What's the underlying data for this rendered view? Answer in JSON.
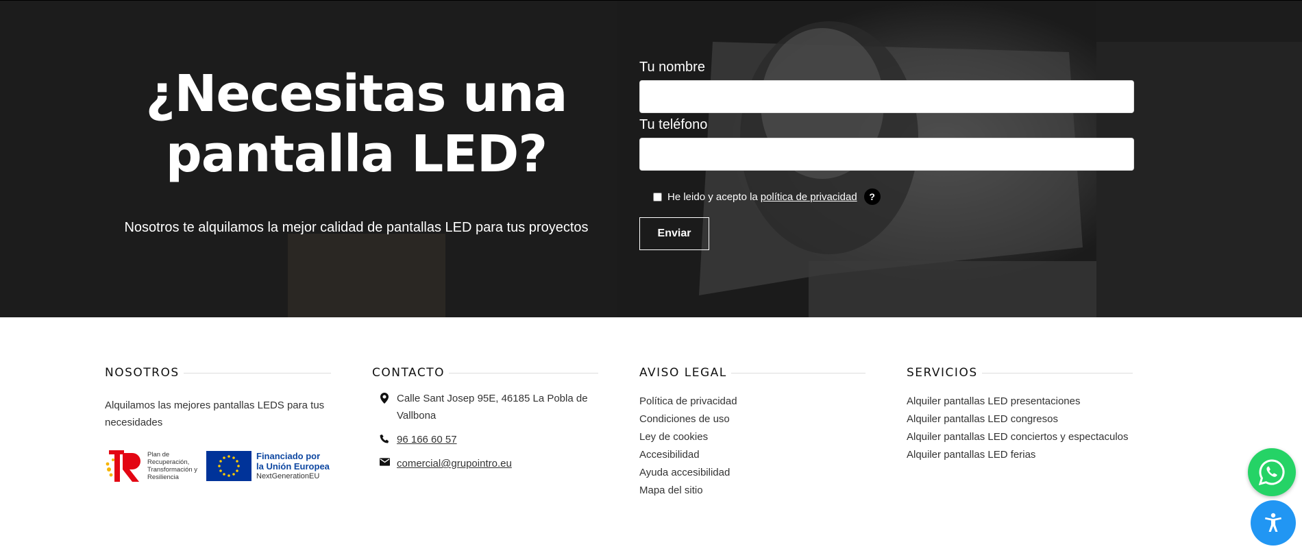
{
  "hero": {
    "title_line1": "¿Necesitas una",
    "title_line2": "pantalla LED?",
    "subtitle": "Nosotros te alquilamos la mejor calidad de pantallas LED para tus proyectos"
  },
  "form": {
    "name_label": "Tu nombre",
    "phone_label": "Tu teléfono",
    "consent_prefix": "He leido y acepto la",
    "consent_link": "política de privacidad",
    "help_glyph": "?",
    "submit_label": "Enviar"
  },
  "footer": {
    "nosotros": {
      "title": "NOSOTROS",
      "text": "Alquilamos las mejores pantallas LEDS para tus necesidades",
      "logo1_text": "Plan de Recuperación, Transformación y Resiliencia",
      "logo2_line1": "Financiado por",
      "logo2_line2": "la Unión Europea",
      "logo2_line3": "NextGenerationEU"
    },
    "contacto": {
      "title": "CONTACTO",
      "address": "Calle Sant Josep 95E, 46185 La Pobla de Vallbona",
      "phone": "96 166 60 57",
      "email": "comercial@grupointro.eu",
      "icons": [
        "map-marker-icon",
        "phone-icon",
        "envelope-icon"
      ]
    },
    "aviso": {
      "title": "AVISO LEGAL",
      "links": [
        "Política de privacidad",
        "Condiciones de uso",
        "Ley de cookies",
        "Accesibilidad",
        "Ayuda accesibilidad",
        "Mapa del sitio"
      ]
    },
    "servicios": {
      "title": "SERVICIOS",
      "links": [
        "Alquiler pantallas LED presentaciones",
        "Alquiler pantallas LED congresos",
        "Alquiler pantallas LED conciertos y espectaculos",
        "Alquiler pantallas LED ferias"
      ]
    }
  },
  "floating": {
    "whatsapp_icon": "whatsapp-icon",
    "accessibility_icon": "accessibility-icon"
  },
  "colors": {
    "hero_bg": "#1b1b1b",
    "whatsapp": "#25d366",
    "accessibility": "#2196f3",
    "eu_blue": "#003399",
    "eu_text": "#0e47a1"
  }
}
